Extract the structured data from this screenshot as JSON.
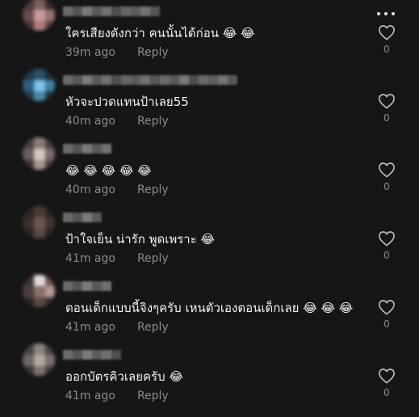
{
  "comments": [
    {
      "text": "ใครเสียงดังกว่า คนนั้นได้ก่อน 😂 😂",
      "time": "39m ago",
      "reply_label": "Reply",
      "likes": "0"
    },
    {
      "text": "หัวจะปวดแทนป้าเลย55",
      "time": "40m ago",
      "reply_label": "Reply",
      "likes": "0"
    },
    {
      "text": "😂 😂 😂 😂 😂",
      "time": "40m ago",
      "reply_label": "Reply",
      "likes": "0"
    },
    {
      "text": "ป้าใจเย็น น่ารัก พูดเพราะ 😂",
      "time": "41m ago",
      "reply_label": "Reply",
      "likes": "0"
    },
    {
      "text": "ตอนเด็กแบบนี้จิงๆครับ เหนตัวเองตอนเด็กเลย 😂 😂 😂",
      "time": "41m ago",
      "reply_label": "Reply",
      "likes": "0"
    },
    {
      "text": "ออกบัตรคิวเลยครับ 😂",
      "time": "41m ago",
      "reply_label": "Reply",
      "likes": "0"
    }
  ],
  "icons": {
    "more": "more-horizontal-icon",
    "like": "heart-outline-icon"
  },
  "colors": {
    "background": "#161616",
    "text": "#f2f2f2",
    "secondary": "#8a8a8a"
  }
}
